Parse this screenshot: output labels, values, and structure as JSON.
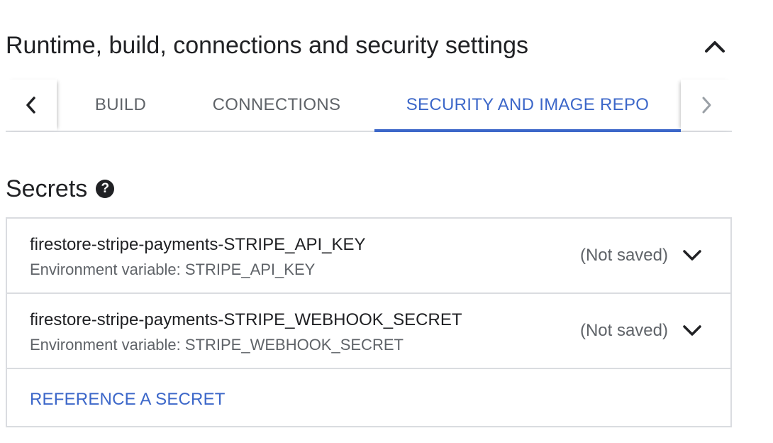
{
  "section": {
    "title": "Runtime, build, connections and security settings",
    "collapse_icon": "chevron-up-icon"
  },
  "tabs": {
    "scroll_left_icon": "chevron-left-icon",
    "scroll_right_icon": "chevron-right-icon",
    "items": [
      {
        "label": "BUILD",
        "active": false
      },
      {
        "label": "CONNECTIONS",
        "active": false
      },
      {
        "label": "SECURITY AND IMAGE REPO",
        "active": true
      }
    ],
    "accent_color": "#3c67c9"
  },
  "secrets": {
    "title": "Secrets",
    "help_icon": "help-circle-icon",
    "items": [
      {
        "name": "firestore-stripe-payments-STRIPE_API_KEY",
        "env": "Environment variable: STRIPE_API_KEY",
        "status": "(Not saved)",
        "expand_icon": "chevron-down-icon"
      },
      {
        "name": "firestore-stripe-payments-STRIPE_WEBHOOK_SECRET",
        "env": "Environment variable: STRIPE_WEBHOOK_SECRET",
        "status": "(Not saved)",
        "expand_icon": "chevron-down-icon"
      }
    ],
    "reference_link": "REFERENCE A SECRET"
  }
}
